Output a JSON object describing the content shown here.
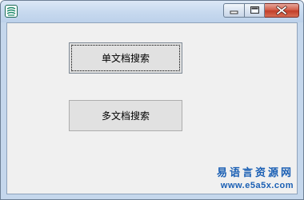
{
  "window": {
    "icon": "app-icon",
    "controls": {
      "minimize_icon": "minimize-icon",
      "maximize_icon": "maximize-icon",
      "close_icon": "close-icon"
    }
  },
  "buttons": {
    "single_doc_search": "单文档搜索",
    "multi_doc_search": "多文档搜索"
  },
  "watermark": {
    "site_name": "易语言资源网",
    "url": "www.e5a5x.com"
  },
  "colors": {
    "titlebar": "#c8daef",
    "close_button": "#c94a37",
    "client_background": "#f0f0f0",
    "watermark_text": "#1a5fb4"
  }
}
